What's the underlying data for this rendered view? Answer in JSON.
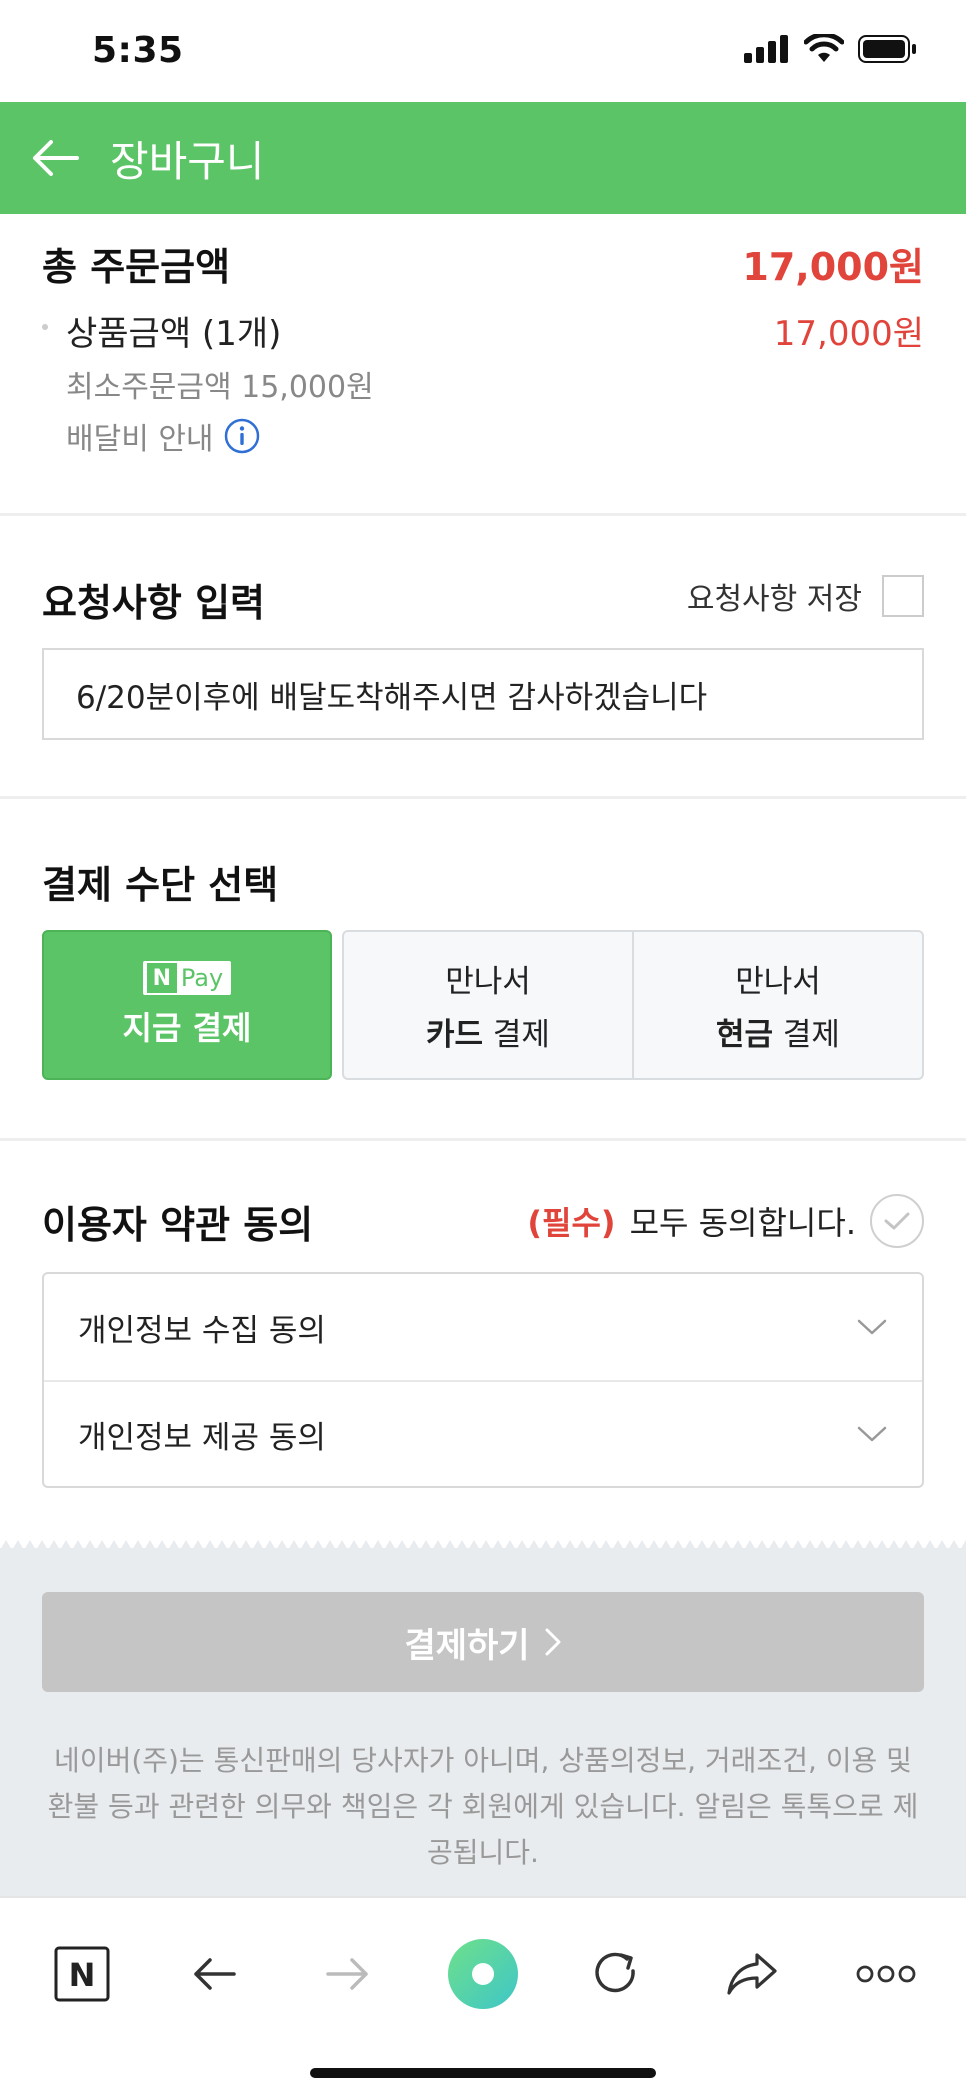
{
  "status_bar": {
    "time": "5:35"
  },
  "header": {
    "title": "장바구니"
  },
  "summary": {
    "total_label": "총 주문금액",
    "total_value": "17,000원",
    "product_label": "상품금액 (1개)",
    "product_value": "17,000원",
    "min_order": "최소주문금액 15,000원",
    "delivery_info": "배달비 안내"
  },
  "request": {
    "title": "요청사항 입력",
    "save_label": "요청사항 저장",
    "value": "6/20분이후에 배달도착해주시면 감사하겠습니다"
  },
  "payment": {
    "title": "결제 수단 선택",
    "npay_n": "N",
    "npay_text": "Pay",
    "pay_now_label": "지금 결제",
    "card_line1": "만나서",
    "card_bold": "카드",
    "card_rest": " 결제",
    "cash_line1": "만나서",
    "cash_bold": "현금",
    "cash_rest": " 결제"
  },
  "terms": {
    "title": "이용자 약관 동의",
    "required": "(필수)",
    "agree_all": "모두 동의합니다.",
    "items": [
      {
        "label": "개인정보 수집 동의"
      },
      {
        "label": "개인정보 제공 동의"
      }
    ]
  },
  "checkout": {
    "button_label": "결제하기",
    "disclaimer": "네이버(주)는 통신판매의 당사자가 아니며, 상품의정보, 거래조건, 이용 및 환불 등과 관련한 의무와 책임은 각 회원에게 있습니다. 알림은 톡톡으로 제공됩니다."
  },
  "browser_bar": {
    "naver_letter": "N"
  },
  "colors": {
    "brand_green": "#5bc466",
    "price_red": "#e0443a",
    "disabled_button": "#c5c5c5"
  }
}
